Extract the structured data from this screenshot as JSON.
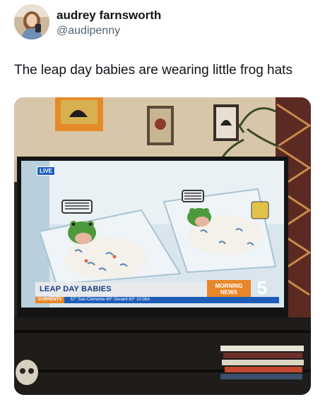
{
  "author": {
    "display_name": "audrey farnsworth",
    "handle": "@audipenny",
    "avatar_icon": "user-avatar"
  },
  "tweet": {
    "text": "The leap day babies are wearing little frog hats"
  },
  "tv_broadcast": {
    "live_badge": "LIVE",
    "lower_third": "LEAP DAY BABIES",
    "brand": "MORNING NEWS",
    "channel": "5",
    "ticker_label": "CURRENTS",
    "ticker_text": "57°  San Clemente  60°  Oxnard  60°  10:06A"
  },
  "colors": {
    "text": "#0f1419",
    "secondary_text": "#536471",
    "news_blue": "#1d5db8",
    "news_orange": "#e8872a",
    "frog_green": "#4d9a3c"
  }
}
